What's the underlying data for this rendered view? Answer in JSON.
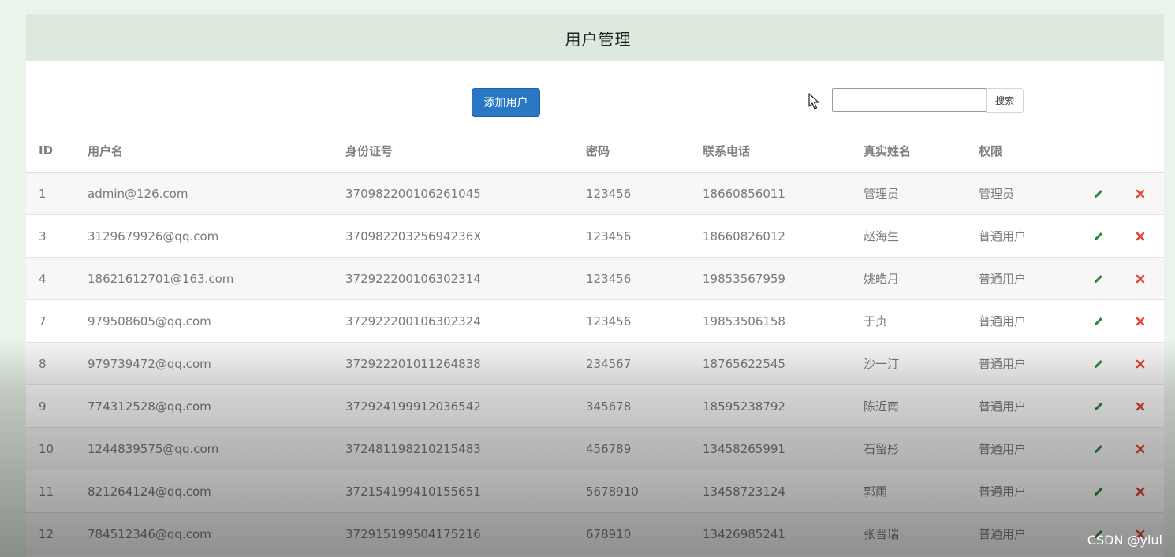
{
  "header": {
    "title": "用户管理"
  },
  "toolbar": {
    "add_label": "添加用户",
    "search_value": "",
    "search_label": "搜索"
  },
  "table": {
    "columns": [
      "ID",
      "用户名",
      "身份证号",
      "密码",
      "联系电话",
      "真实姓名",
      "权限"
    ],
    "rows": [
      [
        "1",
        "admin@126.com",
        "370982200106261045",
        "123456",
        "18660856011",
        "管理员",
        "管理员"
      ],
      [
        "3",
        "3129679926@qq.com",
        "37098220325694236X",
        "123456",
        "18660826012",
        "赵海生",
        "普通用户"
      ],
      [
        "4",
        "18621612701@163.com",
        "372922200106302314",
        "123456",
        "19853567959",
        "姚皓月",
        "普通用户"
      ],
      [
        "7",
        "979508605@qq.com",
        "372922200106302324",
        "123456",
        "19853506158",
        "于贞",
        "普通用户"
      ],
      [
        "8",
        "979739472@qq.com",
        "372922201011264838",
        "234567",
        "18765622545",
        "沙一汀",
        "普通用户"
      ],
      [
        "9",
        "774312528@qq.com",
        "372924199912036542",
        "345678",
        "18595238792",
        "陈近南",
        "普通用户"
      ],
      [
        "10",
        "1244839575@qq.com",
        "372481198210215483",
        "456789",
        "13458265991",
        "石留彤",
        "普通用户"
      ],
      [
        "11",
        "821264124@qq.com",
        "372154199410155651",
        "5678910",
        "13458723124",
        "郭雨",
        "普通用户"
      ],
      [
        "12",
        "784512346@qq.com",
        "372915199504175216",
        "678910",
        "13426985241",
        "张晋瑞",
        "普通用户"
      ]
    ]
  },
  "icons": {
    "edit": "pencil-icon",
    "delete": "close-icon",
    "cursor": "mouse-pointer-icon"
  },
  "colors": {
    "edit": "#2e8b3e",
    "delete": "#e0483a",
    "primary": "#2a78c5",
    "header_bg": "#dce9dc"
  },
  "watermark": "CSDN @yiui"
}
